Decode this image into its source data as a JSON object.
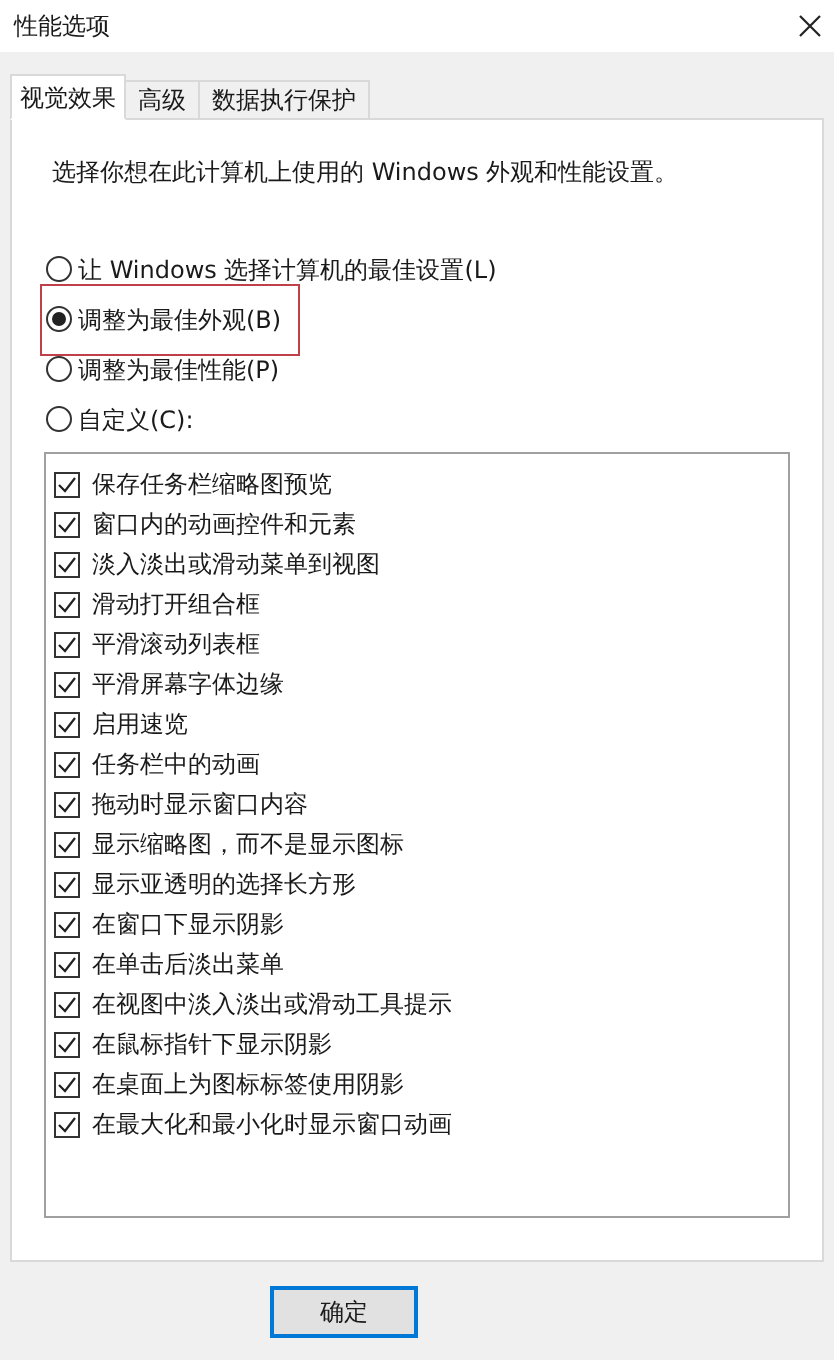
{
  "window": {
    "title": "性能选项"
  },
  "tabs": [
    {
      "label": "视觉效果",
      "selected": true
    },
    {
      "label": "高级",
      "selected": false
    },
    {
      "label": "数据执行保护",
      "selected": false
    }
  ],
  "intro": "选择你想在此计算机上使用的 Windows 外观和性能设置。",
  "options": [
    {
      "label": "让 Windows 选择计算机的最佳设置(L)",
      "selected": false,
      "highlighted": false
    },
    {
      "label": "调整为最佳外观(B)",
      "selected": true,
      "highlighted": true
    },
    {
      "label": "调整为最佳性能(P)",
      "selected": false,
      "highlighted": false
    },
    {
      "label": "自定义(C):",
      "selected": false,
      "highlighted": false
    }
  ],
  "effects": [
    {
      "label": "保存任务栏缩略图预览",
      "checked": true
    },
    {
      "label": "窗口内的动画控件和元素",
      "checked": true
    },
    {
      "label": "淡入淡出或滑动菜单到视图",
      "checked": true
    },
    {
      "label": "滑动打开组合框",
      "checked": true
    },
    {
      "label": "平滑滚动列表框",
      "checked": true
    },
    {
      "label": "平滑屏幕字体边缘",
      "checked": true
    },
    {
      "label": "启用速览",
      "checked": true
    },
    {
      "label": "任务栏中的动画",
      "checked": true
    },
    {
      "label": "拖动时显示窗口内容",
      "checked": true
    },
    {
      "label": "显示缩略图，而不是显示图标",
      "checked": true
    },
    {
      "label": "显示亚透明的选择长方形",
      "checked": true
    },
    {
      "label": "在窗口下显示阴影",
      "checked": true
    },
    {
      "label": "在单击后淡出菜单",
      "checked": true
    },
    {
      "label": "在视图中淡入淡出或滑动工具提示",
      "checked": true
    },
    {
      "label": "在鼠标指针下显示阴影",
      "checked": true
    },
    {
      "label": "在桌面上为图标标签使用阴影",
      "checked": true
    },
    {
      "label": "在最大化和最小化时显示窗口动画",
      "checked": true
    }
  ],
  "buttons": [
    "确定"
  ]
}
